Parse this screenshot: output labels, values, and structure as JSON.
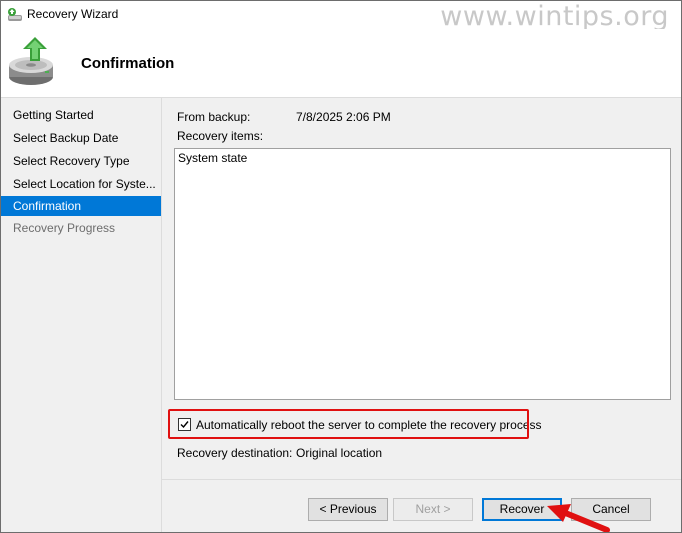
{
  "window": {
    "title": "Recovery Wizard"
  },
  "watermark": "www.wintips.org",
  "header": {
    "title": "Confirmation"
  },
  "nav": {
    "items": [
      {
        "label": "Getting Started",
        "state": "normal"
      },
      {
        "label": "Select Backup Date",
        "state": "normal"
      },
      {
        "label": "Select Recovery Type",
        "state": "normal"
      },
      {
        "label": "Select Location for Syste...",
        "state": "normal"
      },
      {
        "label": "Confirmation",
        "state": "active"
      },
      {
        "label": "Recovery Progress",
        "state": "disabled"
      }
    ]
  },
  "content": {
    "from_backup_label": "From backup:",
    "from_backup_value": "7/8/2025 2:06 PM",
    "recovery_items_label": "Recovery items:",
    "recovery_items": [
      "System state"
    ],
    "reboot_checkbox_label": "Automatically reboot the server to complete the recovery process",
    "reboot_checked": true,
    "destination_label": "Recovery destination:",
    "destination_value": "Original location"
  },
  "buttons": {
    "previous": "< Previous",
    "next": "Next >",
    "recover": "Recover",
    "cancel": "Cancel"
  },
  "colors": {
    "accent": "#0078d7",
    "highlight": "#e01010"
  }
}
